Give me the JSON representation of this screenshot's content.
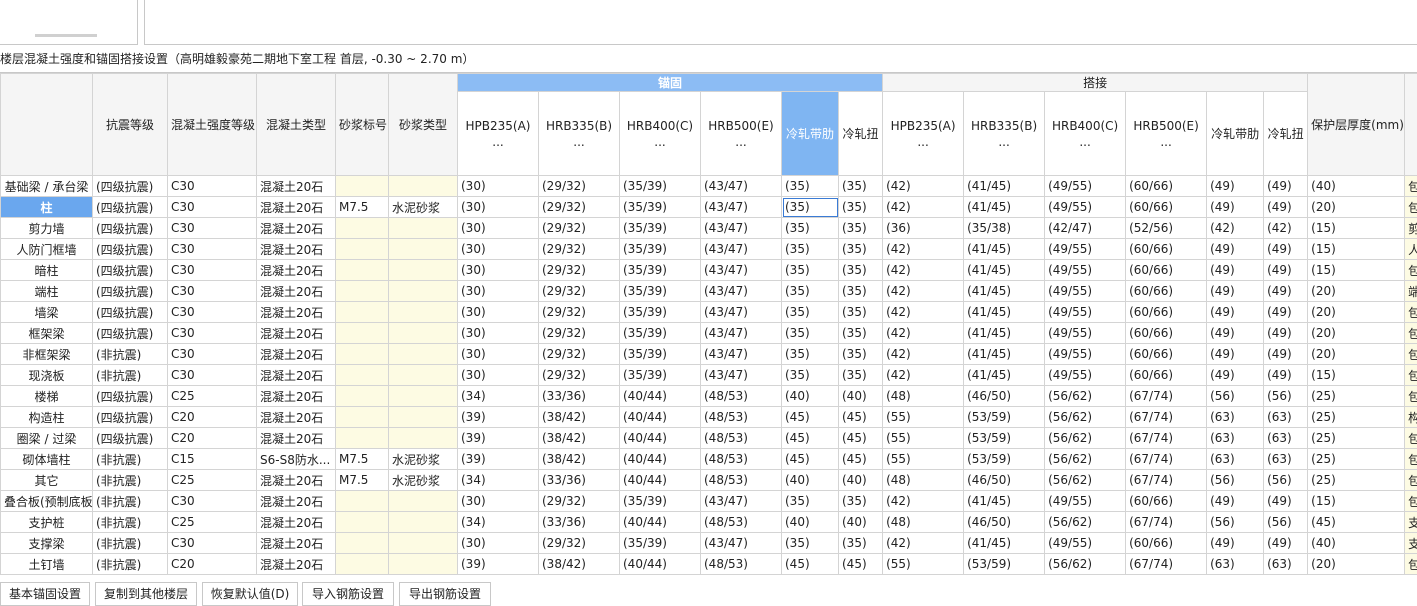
{
  "caption": "楼层混凝土强度和锚固搭接设置（高明雄毅豪苑二期地下室工程  首层, -0.30 ~ 2.70 m）",
  "group_headers": {
    "anchor": "锚固",
    "lap": "搭接"
  },
  "columns": {
    "seismic": "抗震等级",
    "concrete_grade": "混凝土强度等级",
    "concrete_type": "混凝土类型",
    "mortar_grade": "砂浆标号",
    "mortar_type": "砂浆类型",
    "anchor": [
      "HPB235(A)",
      "HRB335(B)",
      "HRB400(C)",
      "HRB500(E)",
      "冷轧带肋",
      "冷轧扭"
    ],
    "lap": [
      "HPB235(A)",
      "HRB335(B)",
      "HRB400(C)",
      "HRB500(E)",
      "冷轧带肋",
      "冷轧扭"
    ],
    "cover": "保护层厚度(mm)",
    "ellipsis": "..."
  },
  "rows": [
    {
      "name": "基础梁 / 承台梁",
      "seismic": "(四级抗震)",
      "grade": "C30",
      "type": "混凝土20石",
      "mgrade": "",
      "mtype": "",
      "a": [
        "(30)",
        "(29/32)",
        "(35/39)",
        "(43/47)",
        "(35)",
        "(35)"
      ],
      "l": [
        "(42)",
        "(41/45)",
        "(49/55)",
        "(60/66)",
        "(49)",
        "(49)"
      ],
      "cover": "(40)",
      "rest": "包"
    },
    {
      "name": "柱",
      "seismic": "(四级抗震)",
      "grade": "C30",
      "type": "混凝土20石",
      "mgrade": "M7.5",
      "mtype": "水泥砂浆",
      "a": [
        "(30)",
        "(29/32)",
        "(35/39)",
        "(43/47)",
        "(35)",
        "(35)"
      ],
      "l": [
        "(42)",
        "(41/45)",
        "(49/55)",
        "(60/66)",
        "(49)",
        "(49)"
      ],
      "cover": "(20)",
      "rest": "包"
    },
    {
      "name": "剪力墙",
      "seismic": "(四级抗震)",
      "grade": "C30",
      "type": "混凝土20石",
      "mgrade": "",
      "mtype": "",
      "a": [
        "(30)",
        "(29/32)",
        "(35/39)",
        "(43/47)",
        "(35)",
        "(35)"
      ],
      "l": [
        "(36)",
        "(35/38)",
        "(42/47)",
        "(52/56)",
        "(42)",
        "(42)"
      ],
      "cover": "(15)",
      "rest": "剪"
    },
    {
      "name": "人防门框墙",
      "seismic": "(四级抗震)",
      "grade": "C30",
      "type": "混凝土20石",
      "mgrade": "",
      "mtype": "",
      "a": [
        "(30)",
        "(29/32)",
        "(35/39)",
        "(43/47)",
        "(35)",
        "(35)"
      ],
      "l": [
        "(42)",
        "(41/45)",
        "(49/55)",
        "(60/66)",
        "(49)",
        "(49)"
      ],
      "cover": "(15)",
      "rest": "人"
    },
    {
      "name": "暗柱",
      "seismic": "(四级抗震)",
      "grade": "C30",
      "type": "混凝土20石",
      "mgrade": "",
      "mtype": "",
      "a": [
        "(30)",
        "(29/32)",
        "(35/39)",
        "(43/47)",
        "(35)",
        "(35)"
      ],
      "l": [
        "(42)",
        "(41/45)",
        "(49/55)",
        "(60/66)",
        "(49)",
        "(49)"
      ],
      "cover": "(15)",
      "rest": "包"
    },
    {
      "name": "端柱",
      "seismic": "(四级抗震)",
      "grade": "C30",
      "type": "混凝土20石",
      "mgrade": "",
      "mtype": "",
      "a": [
        "(30)",
        "(29/32)",
        "(35/39)",
        "(43/47)",
        "(35)",
        "(35)"
      ],
      "l": [
        "(42)",
        "(41/45)",
        "(49/55)",
        "(60/66)",
        "(49)",
        "(49)"
      ],
      "cover": "(20)",
      "rest": "端"
    },
    {
      "name": "墙梁",
      "seismic": "(四级抗震)",
      "grade": "C30",
      "type": "混凝土20石",
      "mgrade": "",
      "mtype": "",
      "a": [
        "(30)",
        "(29/32)",
        "(35/39)",
        "(43/47)",
        "(35)",
        "(35)"
      ],
      "l": [
        "(42)",
        "(41/45)",
        "(49/55)",
        "(60/66)",
        "(49)",
        "(49)"
      ],
      "cover": "(20)",
      "rest": "包"
    },
    {
      "name": "框架梁",
      "seismic": "(四级抗震)",
      "grade": "C30",
      "type": "混凝土20石",
      "mgrade": "",
      "mtype": "",
      "a": [
        "(30)",
        "(29/32)",
        "(35/39)",
        "(43/47)",
        "(35)",
        "(35)"
      ],
      "l": [
        "(42)",
        "(41/45)",
        "(49/55)",
        "(60/66)",
        "(49)",
        "(49)"
      ],
      "cover": "(20)",
      "rest": "包"
    },
    {
      "name": "非框架梁",
      "seismic": "(非抗震)",
      "grade": "C30",
      "type": "混凝土20石",
      "mgrade": "",
      "mtype": "",
      "a": [
        "(30)",
        "(29/32)",
        "(35/39)",
        "(43/47)",
        "(35)",
        "(35)"
      ],
      "l": [
        "(42)",
        "(41/45)",
        "(49/55)",
        "(60/66)",
        "(49)",
        "(49)"
      ],
      "cover": "(20)",
      "rest": "包"
    },
    {
      "name": "现浇板",
      "seismic": "(非抗震)",
      "grade": "C30",
      "type": "混凝土20石",
      "mgrade": "",
      "mtype": "",
      "a": [
        "(30)",
        "(29/32)",
        "(35/39)",
        "(43/47)",
        "(35)",
        "(35)"
      ],
      "l": [
        "(42)",
        "(41/45)",
        "(49/55)",
        "(60/66)",
        "(49)",
        "(49)"
      ],
      "cover": "(15)",
      "rest": "包"
    },
    {
      "name": "楼梯",
      "seismic": "(四级抗震)",
      "grade": "C25",
      "type": "混凝土20石",
      "mgrade": "",
      "mtype": "",
      "a": [
        "(34)",
        "(33/36)",
        "(40/44)",
        "(48/53)",
        "(40)",
        "(40)"
      ],
      "l": [
        "(48)",
        "(46/50)",
        "(56/62)",
        "(67/74)",
        "(56)",
        "(56)"
      ],
      "cover": "(25)",
      "rest": "包"
    },
    {
      "name": "构造柱",
      "seismic": "(四级抗震)",
      "grade": "C20",
      "type": "混凝土20石",
      "mgrade": "",
      "mtype": "",
      "a": [
        "(39)",
        "(38/42)",
        "(40/44)",
        "(48/53)",
        "(45)",
        "(45)"
      ],
      "l": [
        "(55)",
        "(53/59)",
        "(56/62)",
        "(67/74)",
        "(63)",
        "(63)"
      ],
      "cover": "(25)",
      "rest": "构"
    },
    {
      "name": "圈梁 / 过梁",
      "seismic": "(四级抗震)",
      "grade": "C20",
      "type": "混凝土20石",
      "mgrade": "",
      "mtype": "",
      "a": [
        "(39)",
        "(38/42)",
        "(40/44)",
        "(48/53)",
        "(45)",
        "(45)"
      ],
      "l": [
        "(55)",
        "(53/59)",
        "(56/62)",
        "(67/74)",
        "(63)",
        "(63)"
      ],
      "cover": "(25)",
      "rest": "包"
    },
    {
      "name": "砌体墙柱",
      "seismic": "(非抗震)",
      "grade": "C15",
      "type": "S6-S8防水...",
      "mgrade": "M7.5",
      "mtype": "水泥砂浆",
      "a": [
        "(39)",
        "(38/42)",
        "(40/44)",
        "(48/53)",
        "(45)",
        "(45)"
      ],
      "l": [
        "(55)",
        "(53/59)",
        "(56/62)",
        "(67/74)",
        "(63)",
        "(63)"
      ],
      "cover": "(25)",
      "rest": "包"
    },
    {
      "name": "其它",
      "seismic": "(非抗震)",
      "grade": "C25",
      "type": "混凝土20石",
      "mgrade": "M7.5",
      "mtype": "水泥砂浆",
      "a": [
        "(34)",
        "(33/36)",
        "(40/44)",
        "(48/53)",
        "(40)",
        "(40)"
      ],
      "l": [
        "(48)",
        "(46/50)",
        "(56/62)",
        "(67/74)",
        "(56)",
        "(56)"
      ],
      "cover": "(25)",
      "rest": "包"
    },
    {
      "name": "叠合板(预制底板)",
      "seismic": "(非抗震)",
      "grade": "C30",
      "type": "混凝土20石",
      "mgrade": "",
      "mtype": "",
      "a": [
        "(30)",
        "(29/32)",
        "(35/39)",
        "(43/47)",
        "(35)",
        "(35)"
      ],
      "l": [
        "(42)",
        "(41/45)",
        "(49/55)",
        "(60/66)",
        "(49)",
        "(49)"
      ],
      "cover": "(15)",
      "rest": "包"
    },
    {
      "name": "支护桩",
      "seismic": "(非抗震)",
      "grade": "C25",
      "type": "混凝土20石",
      "mgrade": "",
      "mtype": "",
      "a": [
        "(34)",
        "(33/36)",
        "(40/44)",
        "(48/53)",
        "(40)",
        "(40)"
      ],
      "l": [
        "(48)",
        "(46/50)",
        "(56/62)",
        "(67/74)",
        "(56)",
        "(56)"
      ],
      "cover": "(45)",
      "rest": "支"
    },
    {
      "name": "支撑梁",
      "seismic": "(非抗震)",
      "grade": "C30",
      "type": "混凝土20石",
      "mgrade": "",
      "mtype": "",
      "a": [
        "(30)",
        "(29/32)",
        "(35/39)",
        "(43/47)",
        "(35)",
        "(35)"
      ],
      "l": [
        "(42)",
        "(41/45)",
        "(49/55)",
        "(60/66)",
        "(49)",
        "(49)"
      ],
      "cover": "(40)",
      "rest": "支"
    },
    {
      "name": "土钉墙",
      "seismic": "(非抗震)",
      "grade": "C20",
      "type": "混凝土20石",
      "mgrade": "",
      "mtype": "",
      "a": [
        "(39)",
        "(38/42)",
        "(40/44)",
        "(48/53)",
        "(45)",
        "(45)"
      ],
      "l": [
        "(55)",
        "(53/59)",
        "(56/62)",
        "(67/74)",
        "(63)",
        "(63)"
      ],
      "cover": "(20)",
      "rest": "包"
    }
  ],
  "buttons": [
    "基本锚固设置",
    "复制到其他楼层",
    "恢复默认值(D)",
    "导入钢筋设置",
    "导出钢筋设置"
  ]
}
